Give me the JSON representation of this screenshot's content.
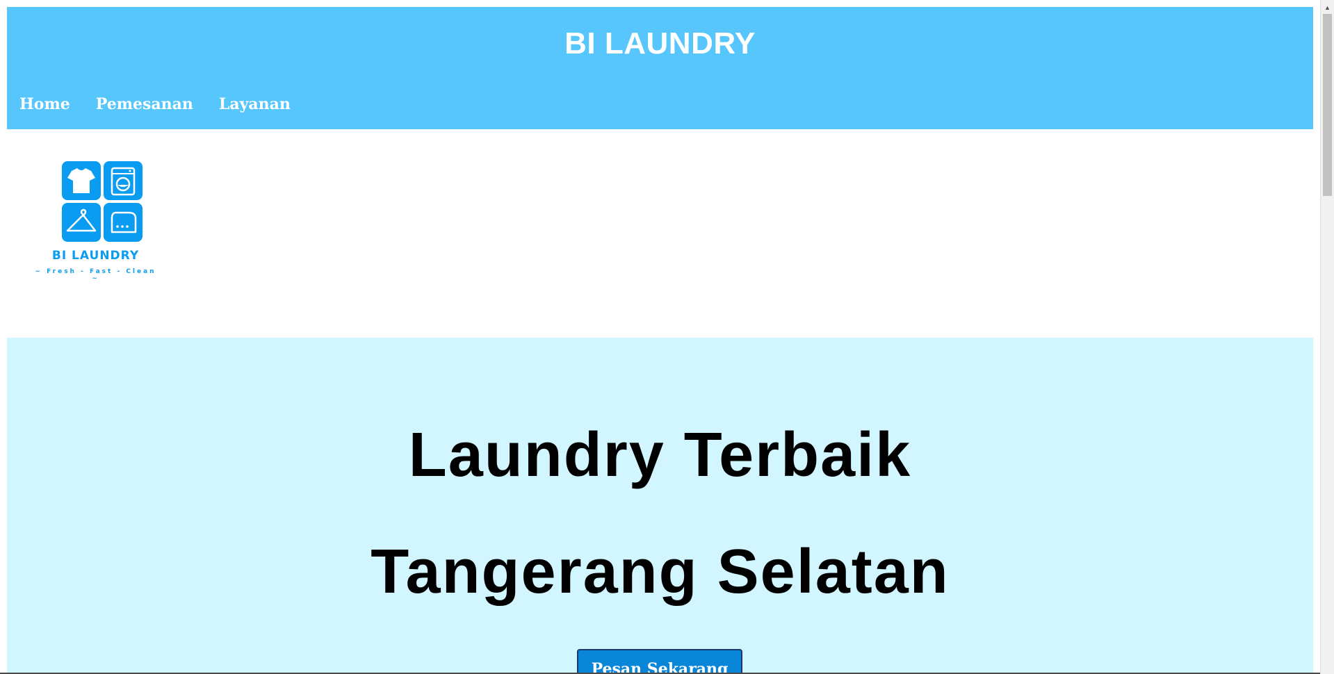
{
  "header": {
    "title": "BI LAUNDRY",
    "background_color": "#56c6fd"
  },
  "nav": {
    "items": [
      {
        "label": "Home"
      },
      {
        "label": "Pemesanan"
      },
      {
        "label": "Layanan"
      }
    ]
  },
  "logo": {
    "name": "BI LAUNDRY",
    "tagline": "~ Fresh - Fast - Clean ~",
    "icons": [
      "tshirt-icon",
      "washing-machine-icon",
      "hanger-icon",
      "iron-icon"
    ],
    "color": "#0a9cf0"
  },
  "hero": {
    "line1": "Laundry Terbaik",
    "line2": "Tangerang Selatan",
    "button_label": "Pesan Sekarang",
    "background_color": "#d2f6ff",
    "button_color": "#0a86d9"
  }
}
